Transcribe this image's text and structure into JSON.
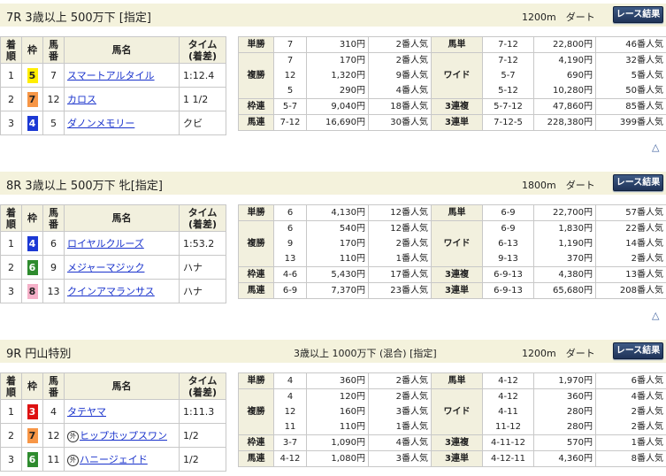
{
  "colors": {
    "header_bg": "#f4f2dc",
    "label_bg": "#f2f0de",
    "link": "#1a33cc",
    "button": "#2b4470",
    "waku_yellow": "#ffee00",
    "waku_orange": "#f79646",
    "waku_blue": "#1c39d4",
    "waku_green": "#2e8b2e",
    "waku_pink": "#f5b0c8",
    "waku_red": "#dd1111"
  },
  "headers": {
    "chakujun": "着順",
    "waku": "枠",
    "umaban": "馬番",
    "bamei": "馬名",
    "time": "タイム(着差)"
  },
  "pay_labels": {
    "tansho": "単勝",
    "fukusho": "複勝",
    "wakuren": "枠連",
    "umaren": "馬連",
    "umatan": "馬単",
    "wide": "ワイド",
    "sanrenpuku": "3連複",
    "sanrentan": "3連単"
  },
  "result_button": "レース結果",
  "up_icon": "△",
  "races": [
    {
      "title": "7R 3歳以上 500万下 [指定]",
      "condition": "",
      "distance": "1200m　ダート",
      "results": [
        {
          "pos": "1",
          "waku": "5",
          "num": "7",
          "name": "スマートアルタイル",
          "mark": "",
          "time": "1:12.4"
        },
        {
          "pos": "2",
          "waku": "7",
          "num": "12",
          "name": "カロス",
          "mark": "",
          "time": "1 1/2"
        },
        {
          "pos": "3",
          "waku": "4",
          "num": "5",
          "name": "ダノンメモリー",
          "mark": "",
          "time": "クビ"
        }
      ],
      "tansho": {
        "num": "7",
        "amt": "310円",
        "pop": "2番人気"
      },
      "fukusho": {
        "nums": [
          "7",
          "12",
          "5"
        ],
        "amts": [
          "170円",
          "1,320円",
          "290円"
        ],
        "pops": [
          "2番人気",
          "9番人気",
          "4番人気"
        ]
      },
      "wakuren": {
        "num": "5-7",
        "amt": "9,040円",
        "pop": "18番人気"
      },
      "umaren": {
        "num": "7-12",
        "amt": "16,690円",
        "pop": "30番人気"
      },
      "umatan": {
        "num": "7-12",
        "amt": "22,800円",
        "pop": "46番人気"
      },
      "wide": {
        "nums": [
          "7-12",
          "5-7",
          "5-12"
        ],
        "amts": [
          "4,190円",
          "690円",
          "10,280円"
        ],
        "pops": [
          "32番人気",
          "5番人気",
          "50番人気"
        ]
      },
      "sanrenpuku": {
        "num": "5-7-12",
        "amt": "47,860円",
        "pop": "85番人気"
      },
      "sanrentan": {
        "num": "7-12-5",
        "amt": "228,380円",
        "pop": "399番人気"
      }
    },
    {
      "title": "8R 3歳以上 500万下 牝[指定]",
      "condition": "",
      "distance": "1800m　ダート",
      "results": [
        {
          "pos": "1",
          "waku": "4",
          "num": "6",
          "name": "ロイヤルクルーズ",
          "mark": "",
          "time": "1:53.2"
        },
        {
          "pos": "2",
          "waku": "6",
          "num": "9",
          "name": "メジャーマジック",
          "mark": "",
          "time": "ハナ"
        },
        {
          "pos": "3",
          "waku": "8",
          "num": "13",
          "name": "クインアマランサス",
          "mark": "",
          "time": "ハナ"
        }
      ],
      "tansho": {
        "num": "6",
        "amt": "4,130円",
        "pop": "12番人気"
      },
      "fukusho": {
        "nums": [
          "6",
          "9",
          "13"
        ],
        "amts": [
          "540円",
          "170円",
          "110円"
        ],
        "pops": [
          "12番人気",
          "2番人気",
          "1番人気"
        ]
      },
      "wakuren": {
        "num": "4-6",
        "amt": "5,430円",
        "pop": "17番人気"
      },
      "umaren": {
        "num": "6-9",
        "amt": "7,370円",
        "pop": "23番人気"
      },
      "umatan": {
        "num": "6-9",
        "amt": "22,700円",
        "pop": "57番人気"
      },
      "wide": {
        "nums": [
          "6-9",
          "6-13",
          "9-13"
        ],
        "amts": [
          "1,830円",
          "1,190円",
          "370円"
        ],
        "pops": [
          "22番人気",
          "14番人気",
          "2番人気"
        ]
      },
      "sanrenpuku": {
        "num": "6-9-13",
        "amt": "4,380円",
        "pop": "13番人気"
      },
      "sanrentan": {
        "num": "6-9-13",
        "amt": "65,680円",
        "pop": "208番人気"
      }
    },
    {
      "title": "9R 円山特別",
      "condition": "3歳以上 1000万下 (混合) [指定]",
      "distance": "1200m　ダート",
      "results": [
        {
          "pos": "1",
          "waku": "3",
          "num": "4",
          "name": "タテヤマ",
          "mark": "",
          "time": "1:11.3"
        },
        {
          "pos": "2",
          "waku": "7",
          "num": "12",
          "name": "ヒップホップスワン",
          "mark": "外",
          "time": "1/2"
        },
        {
          "pos": "3",
          "waku": "6",
          "num": "11",
          "name": "ハニージェイド",
          "mark": "外",
          "time": "1/2"
        }
      ],
      "tansho": {
        "num": "4",
        "amt": "360円",
        "pop": "2番人気"
      },
      "fukusho": {
        "nums": [
          "4",
          "12",
          "11"
        ],
        "amts": [
          "120円",
          "160円",
          "110円"
        ],
        "pops": [
          "2番人気",
          "3番人気",
          "1番人気"
        ]
      },
      "wakuren": {
        "num": "3-7",
        "amt": "1,090円",
        "pop": "4番人気"
      },
      "umaren": {
        "num": "4-12",
        "amt": "1,080円",
        "pop": "3番人気"
      },
      "umatan": {
        "num": "4-12",
        "amt": "1,970円",
        "pop": "6番人気"
      },
      "wide": {
        "nums": [
          "4-12",
          "4-11",
          "11-12"
        ],
        "amts": [
          "360円",
          "280円",
          "280円"
        ],
        "pops": [
          "4番人気",
          "2番人気",
          "2番人気"
        ]
      },
      "sanrenpuku": {
        "num": "4-11-12",
        "amt": "570円",
        "pop": "1番人気"
      },
      "sanrentan": {
        "num": "4-12-11",
        "amt": "4,360円",
        "pop": "8番人気"
      }
    }
  ]
}
